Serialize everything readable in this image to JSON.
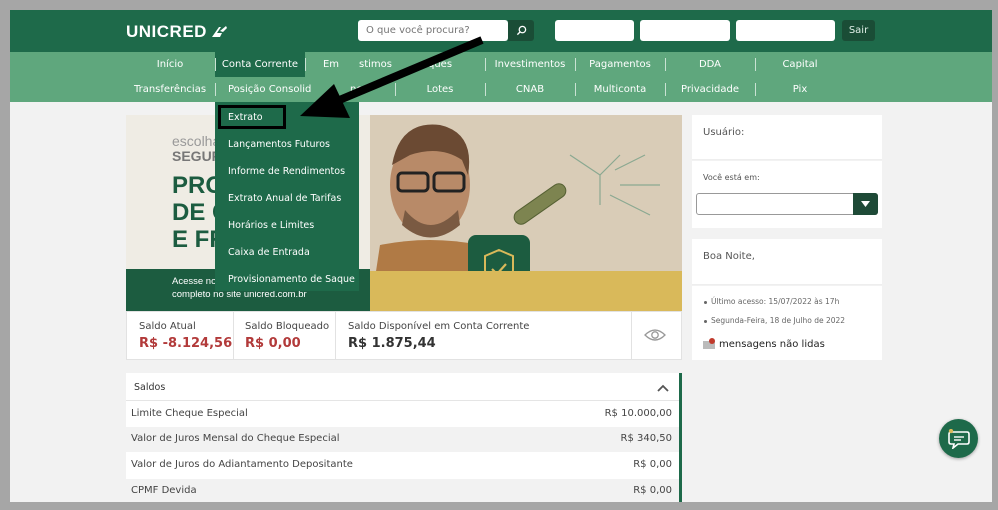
{
  "brand": {
    "name": "UNICRED"
  },
  "header": {
    "search_placeholder": "O que você procura?",
    "logout_label": "Sair"
  },
  "nav": {
    "row1": [
      "Início",
      "Conta Corrente",
      "Empréstimos",
      "Cheques",
      "Investimentos",
      "Pagamentos",
      "DDA",
      "Capital"
    ],
    "row2": [
      "Transferências",
      "Posição Consolidada",
      "Segurança",
      "Lotes",
      "CNAB",
      "Multiconta",
      "Privacidade",
      "Pix"
    ],
    "row1_visible": [
      "Início",
      "Conta Corrente",
      "Em",
      "stimos",
      "ques",
      "Investimentos",
      "Pagamentos",
      "DDA",
      "Capital"
    ],
    "row2_visible": [
      "Transferências",
      "Posição Consolid",
      "nça",
      "Lotes",
      "CNAB",
      "Multiconta",
      "Privacidade",
      "Pix"
    ]
  },
  "dropdown": {
    "items": [
      "Extrato",
      "Lançamentos Futuros",
      "Informe de Rendimentos",
      "Extrato Anual de Tarifas",
      "Horários e Limites",
      "Caixa de Entrada",
      "Provisionamento de Saque"
    ]
  },
  "banner": {
    "small1": "escolha",
    "small2": "SEGUR",
    "big1": "PRO",
    "big2": "DE C",
    "big3": "E FR",
    "foot1": "Acesse no",
    "foot2": "completo no site unicred.com.br"
  },
  "balances": [
    {
      "label": "Saldo Atual",
      "value": "R$ -8.124,56",
      "color": "#b23a3a"
    },
    {
      "label": "Saldo Bloqueado",
      "value": "R$ 0,00",
      "color": "#b23a3a"
    },
    {
      "label": "Saldo Disponível em Conta Corrente",
      "value": "R$ 1.875,44",
      "color": "#333333"
    }
  ],
  "saldos": {
    "title": "Saldos",
    "rows": [
      {
        "label": "Limite Cheque Especial",
        "value": "R$ 10.000,00"
      },
      {
        "label": "Valor de Juros Mensal do Cheque Especial",
        "value": "R$ 340,50"
      },
      {
        "label": "Valor de Juros do Adiantamento Depositante",
        "value": "R$ 0,00"
      },
      {
        "label": "CPMF Devida",
        "value": "R$ 0,00"
      }
    ]
  },
  "sidebar": {
    "user_label": "Usuário:",
    "location_label": "Você está em:",
    "greeting": "Boa Noite,",
    "last_access": "Último acesso: 15/07/2022 às 17h",
    "date": "Segunda-Feira, 18 de Julho de 2022",
    "messages": "mensagens não lidas"
  },
  "colors": {
    "primary": "#1e6a4a",
    "nav": "#5fa77d",
    "negative": "#b23a3a",
    "gold": "#d9b95a"
  }
}
